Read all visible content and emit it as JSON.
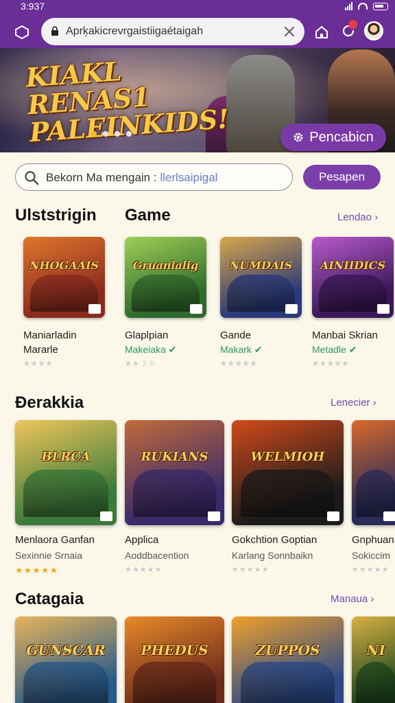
{
  "status": {
    "time": "3:937"
  },
  "browser": {
    "url": "Aprķakicrevrgaistiigaétaigah"
  },
  "hero": {
    "title": "KIAKL RENAS1\nPALEINKIDS!",
    "button": "Pencabicn",
    "dots": 4
  },
  "search": {
    "query": "Bekorn Ma mengain :",
    "placeholder": "llerlsaipigal",
    "button": "Pesapen"
  },
  "section1": {
    "title1": "Ulststrigin",
    "title2": "Game",
    "link": "Lendao",
    "cards": [
      {
        "art": "NHOGAAIS",
        "name": "Maniarladin",
        "name2": "Mararle",
        "sub": "",
        "rating": "★★★★",
        "colors": [
          "#8a2b1e",
          "#e0762d"
        ]
      },
      {
        "art": "Gruanlalig",
        "name": "Glaplpian",
        "sub": "Makeiaka",
        "rating": "★★ 2 0",
        "colors": [
          "#2f6a2c",
          "#9fcf56"
        ]
      },
      {
        "art": "NUMDAIS",
        "name": "Gande",
        "sub": "Makark",
        "rating": "★★★★★",
        "colors": [
          "#2a3a7a",
          "#d8a64a"
        ]
      },
      {
        "art": "AINIIDICS",
        "name": "Manbai Skrian",
        "sub": "Metadle",
        "rating": "★★★★★",
        "colors": [
          "#3a1758",
          "#b75acc"
        ]
      }
    ]
  },
  "section2": {
    "title": "Đerakkia",
    "link": "Lenecier",
    "cards": [
      {
        "art": "BLRCA",
        "name": "Menlaora Ganfan",
        "sub": "Sexinnie Srnaia",
        "rating": "★★★★★",
        "gold": true,
        "colors": [
          "#3a7a3a",
          "#f0c65a"
        ]
      },
      {
        "art": "RUKIANS",
        "name": "Applica",
        "sub": "Aoddbacention",
        "rating": "★★★★★",
        "gold": false,
        "colors": [
          "#3a2a6a",
          "#c26a3a"
        ]
      },
      {
        "art": "WELMIOH",
        "name": "Gokchtion Goptian",
        "sub": "Karlang Sonnbaikn",
        "rating": "★★★★★",
        "gold": false,
        "colors": [
          "#1b1b1b",
          "#d24a1a"
        ]
      },
      {
        "art": "",
        "name": "Gnphuan",
        "sub": "Sokiccim",
        "rating": "★★★★★",
        "gold": false,
        "colors": [
          "#2b2b5a",
          "#d96a2a"
        ]
      }
    ]
  },
  "section3": {
    "title": "Catagaia",
    "link": "Manaua",
    "cards": [
      {
        "art": "GUNSCAR",
        "colors": [
          "#2a5a8a",
          "#e6b45a"
        ]
      },
      {
        "art": "PHEDUS",
        "colors": [
          "#6a2a1a",
          "#e88a2a"
        ]
      },
      {
        "art": "ZUPPOS",
        "colors": [
          "#2a4a8a",
          "#f0a02a"
        ]
      },
      {
        "art": "NI",
        "colors": [
          "#1f4a1f",
          "#d8b040"
        ]
      }
    ]
  },
  "colors": {
    "accent": "#7b3fa9",
    "topbar": "#6a2e96",
    "background": "#fbf8ea"
  }
}
